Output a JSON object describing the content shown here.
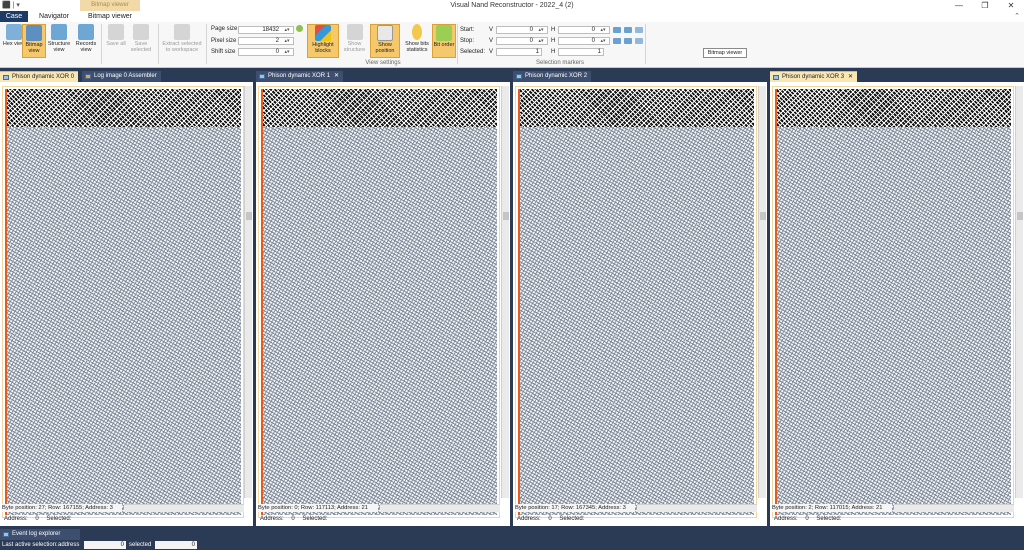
{
  "window": {
    "title": "Visual Nand Reconstructor - 2022_4 (2)",
    "context_tab": "Bitmap viewer",
    "quick_access": "⬛ | ▾",
    "minimize": "—",
    "maximize": "❐",
    "close": "✕"
  },
  "ribbon_tabs": [
    {
      "label": "Case"
    },
    {
      "label": "Navigator"
    },
    {
      "label": "Bitmap viewer"
    }
  ],
  "ribbon": {
    "view_buttons": [
      {
        "label": "Hex view",
        "icon": "hex-view-icon"
      },
      {
        "label": "Bitmap view",
        "icon": "bitmap-view-icon"
      },
      {
        "label": "Structure view",
        "icon": "structure-view-icon"
      },
      {
        "label": "Records view",
        "icon": "records-view-icon"
      }
    ],
    "save_all": "Save all",
    "save_selected": "Save selected",
    "extract_selected": "Extract selected to workspace",
    "page_size_label": "Page size",
    "page_size_value": "18432",
    "pixel_size_label": "Pixel size",
    "pixel_size_value": "2",
    "shift_size_label": "Shift size",
    "shift_size_value": "0",
    "highlight_blocks": "Highlight blocks",
    "show_structure": "Show structure",
    "show_position": "Show position",
    "show_bits_statistics": "Show bits statistics",
    "bit_order": "Bit order",
    "view_settings_label": "View settings",
    "start_label": "Start:",
    "stop_label": "Stop:",
    "selected_label": "Selected:",
    "v_label": "V",
    "h_label": "H",
    "start_v": "0",
    "start_h": "0",
    "stop_v": "0",
    "stop_h": "0",
    "selected_v": "1",
    "selected_h": "1",
    "selection_markers_label": "Selection markers",
    "tooltip": "Bitmap viewer"
  },
  "panels": [
    {
      "tabs": [
        {
          "label": "Phison dynamic XOR 0"
        },
        {
          "label": "Log image 0 Assembler"
        }
      ],
      "status": "Byte position: 27; Row: 167155; Address: 3",
      "address_label": "Address:",
      "address_value": "0",
      "selected_label": "Selected:"
    },
    {
      "tabs": [
        {
          "label": "Phison dynamic XOR 1"
        }
      ],
      "status": "Byte position: 0; Row: 117113; Address: 21",
      "address_label": "Address:",
      "address_value": "0",
      "selected_label": "Selected:"
    },
    {
      "tabs": [
        {
          "label": "Phison dynamic XOR 2"
        }
      ],
      "status": "Byte position: 17; Row: 167345; Address: 3",
      "address_label": "Address:",
      "address_value": "0",
      "selected_label": "Selected:"
    },
    {
      "tabs": [
        {
          "label": "Phison dynamic XOR 3"
        }
      ],
      "status": "Byte position: 2; Row: 117015; Address: 21",
      "address_label": "Address:",
      "address_value": "0",
      "selected_label": "Selected:"
    }
  ],
  "event_log": "Event log explorer",
  "statusbar": {
    "last_active_selection": "Last active selection:",
    "address_label": "address",
    "address_value": "0",
    "selected_label": "selected",
    "selected_value": "0"
  },
  "colors": {
    "accent": "#1e3a66",
    "active_button": "#f4c86b",
    "bitmap_border": "#e55c1e",
    "tab_active": "#f9e7b3"
  }
}
